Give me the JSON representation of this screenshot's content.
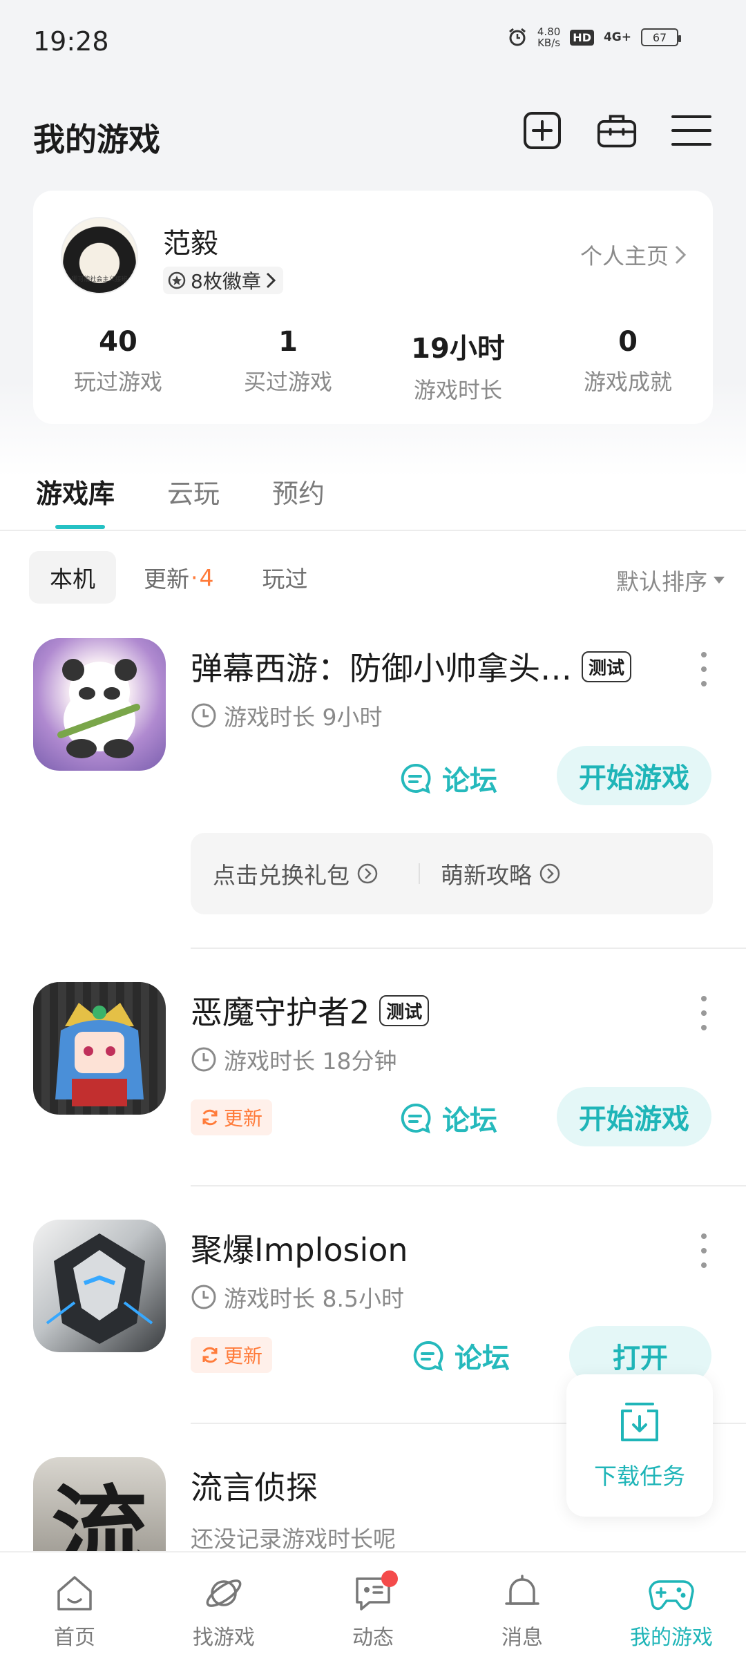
{
  "status_bar": {
    "time": "19:28",
    "net_speed_value": "4.80",
    "net_speed_unit": "KB/s",
    "hd_label": "HD",
    "signal_label": "4G+",
    "battery": "67"
  },
  "header": {
    "title": "我的游戏",
    "icons": [
      "add-icon",
      "toolbox-icon",
      "menu-icon"
    ]
  },
  "profile": {
    "name": "范毅",
    "avatar_caption": "哪可能社会主义接班",
    "badges_label": "8枚徽章",
    "homepage_label": "个人主页",
    "stats": [
      {
        "value": "40",
        "label": "玩过游戏"
      },
      {
        "value": "1",
        "label": "买过游戏"
      },
      {
        "value": "19小时",
        "label": "游戏时长"
      },
      {
        "value": "0",
        "label": "游戏成就"
      }
    ]
  },
  "main_tabs": [
    "游戏库",
    "云玩",
    "预约"
  ],
  "filters": {
    "local": "本机",
    "update": "更新",
    "update_dot": "·",
    "update_count": "4",
    "played": "玩过",
    "sort": "默认排序"
  },
  "games": [
    {
      "name": "弹幕西游：防御小帅拿头…",
      "tag": "测试",
      "playtime": "游戏时长 9小时",
      "forum_label": "论坛",
      "action_label": "开始游戏",
      "gift_label": "点击兑换礼包",
      "guide_label": "萌新攻略"
    },
    {
      "name": "恶魔守护者2",
      "tag": "测试",
      "playtime": "游戏时长 18分钟",
      "update_label": "更新",
      "forum_label": "论坛",
      "action_label": "开始游戏"
    },
    {
      "name": "聚爆Implosion",
      "playtime": "游戏时长 8.5小时",
      "update_label": "更新",
      "forum_label": "论坛",
      "action_label": "打开"
    },
    {
      "name": "流言侦探",
      "icon_char": "流",
      "playtime": "还没记录游戏时长呢"
    }
  ],
  "download_task": {
    "label": "下载任务"
  },
  "bottom_nav": [
    {
      "label": "首页",
      "icon": "home-icon"
    },
    {
      "label": "找游戏",
      "icon": "planet-icon"
    },
    {
      "label": "动态",
      "icon": "chat-icon"
    },
    {
      "label": "消息",
      "icon": "bell-icon"
    },
    {
      "label": "我的游戏",
      "icon": "gamepad-icon"
    }
  ],
  "colors": {
    "accent": "#1fb5b8",
    "accent_light": "#e4f7f7",
    "update_orange": "#ff7b3a",
    "notification_red": "#f44b4b"
  }
}
